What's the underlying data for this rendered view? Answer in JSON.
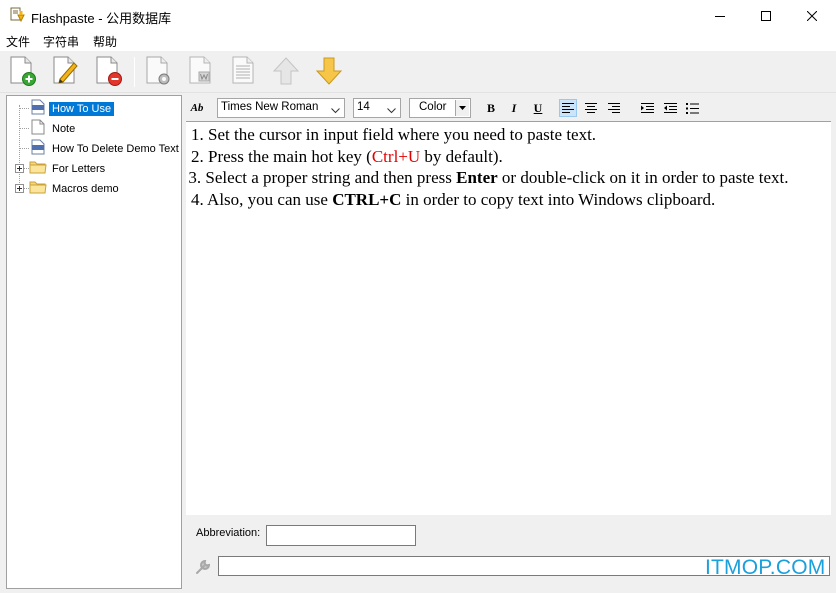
{
  "window": {
    "title": "Flashpaste - 公用数据库"
  },
  "menu": {
    "items": [
      "文件",
      "字符串",
      "帮助"
    ]
  },
  "toolbar": {
    "buttons": [
      {
        "icon": "new-document-add-icon"
      },
      {
        "icon": "edit-document-icon"
      },
      {
        "icon": "delete-document-icon"
      },
      {
        "icon": "document-settings-icon"
      },
      {
        "icon": "word-document-icon"
      },
      {
        "icon": "text-document-icon"
      },
      {
        "icon": "arrow-up-icon"
      },
      {
        "icon": "arrow-down-icon"
      }
    ]
  },
  "tree": {
    "items": [
      {
        "label": "How To Use",
        "selected": true,
        "icon": "rtf-file-icon"
      },
      {
        "label": "Note",
        "selected": false,
        "icon": "text-file-icon"
      },
      {
        "label": "How To Delete Demo Text",
        "selected": false,
        "icon": "rtf-file-icon"
      },
      {
        "label": "For Letters",
        "selected": false,
        "icon": "folder-icon"
      },
      {
        "label": "Macros demo",
        "selected": false,
        "icon": "folder-icon"
      }
    ]
  },
  "format": {
    "font_name": "Times New Roman",
    "font_size": "14",
    "color_label": "Color",
    "bold": "B",
    "italic": "I",
    "underline": "U",
    "style_label": "Ab"
  },
  "editor": {
    "line1": "1. Set the cursor in input field where you need to paste text.",
    "line2_pre": "2. Press the main hot key (",
    "line2_key": "Ctrl+U",
    "line2_post": " by default).",
    "line3_pre": "3. Select a proper string and then press ",
    "line3_key": "Enter",
    "line3_post": " or double-click on it in order to paste text.",
    "line4_pre": "4. Also, you can use ",
    "line4_key": "CTRL+C",
    "line4_post": " in order to copy text into Windows clipboard."
  },
  "abbreviation": {
    "label": "Abbreviation:",
    "value": ""
  },
  "watermark": "ITMOP.COM",
  "colors": {
    "accent": "#0078d7",
    "highlight_text": "#e00000",
    "watermark": "#1aa0dc"
  }
}
